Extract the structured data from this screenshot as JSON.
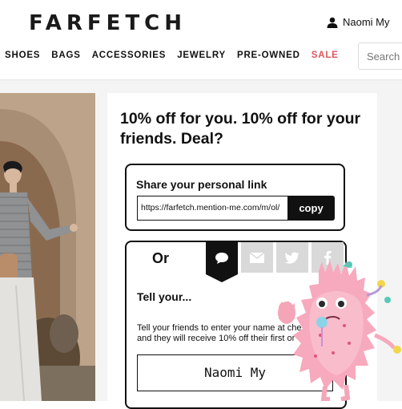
{
  "header": {
    "logo": "FARFETCH",
    "account_name": "Naomi My"
  },
  "nav": {
    "items": [
      "SHOES",
      "BAGS",
      "ACCESSORIES",
      "JEWELRY",
      "PRE-OWNED"
    ],
    "sale": "SALE",
    "sale_color": "#e0555d"
  },
  "search": {
    "placeholder": "Search"
  },
  "offer": {
    "heading": "10% off for you. 10% off for your friends. Deal?",
    "share_title": "Share your personal link",
    "link_value": "https://farfetch.mention-me.com/m/ol/",
    "copy_label": "copy",
    "or_label": "Or",
    "tabs": [
      "speech-bubble-icon",
      "envelope-icon",
      "twitter-bird-icon",
      "facebook-f-icon"
    ],
    "tell_title": "Tell your...",
    "tell_text_line1": "Tell your friends to enter your name at che",
    "tell_text_line2": "and they will receive 10% off their first or",
    "name_value": "Naomi My"
  }
}
